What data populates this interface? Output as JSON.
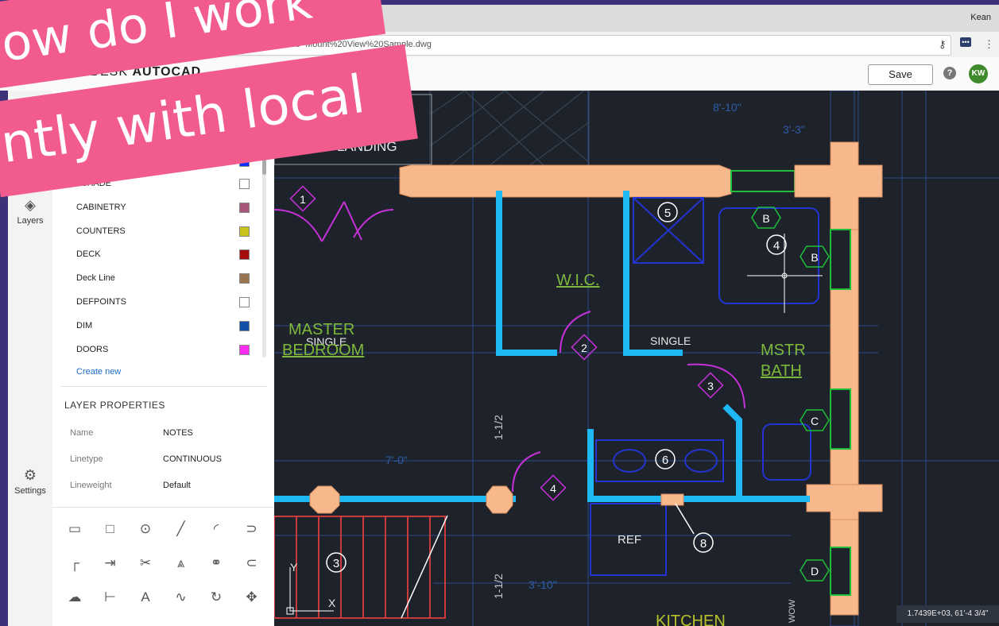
{
  "browser": {
    "user": "Kean",
    "url": "...name=Mount%20View%20Sample.dwg"
  },
  "app": {
    "logo_prefix": "ODESK",
    "logo_name": "AUTOCAD",
    "save_label": "Save",
    "help_glyph": "?",
    "avatar_initials": "KW"
  },
  "rail": {
    "layers_label": "Layers",
    "settings_label": "Settings"
  },
  "layers": [
    {
      "name": "3SHADE",
      "color": "#ffffff"
    },
    {
      "name": "CABINETRY",
      "color": "#a8557a"
    },
    {
      "name": "COUNTERS",
      "color": "#c9c21c"
    },
    {
      "name": "DECK",
      "color": "#a50d0d"
    },
    {
      "name": "Deck Line",
      "color": "#9a7350"
    },
    {
      "name": "DEFPOINTS",
      "color": "#ffffff"
    },
    {
      "name": "DIM",
      "color": "#1150a8"
    },
    {
      "name": "DOORS",
      "color": "#ff2df0"
    }
  ],
  "first_layer_color": "#0a2ef5",
  "create_new_label": "Create new",
  "layer_properties": {
    "title": "LAYER PROPERTIES",
    "name_label": "Name",
    "name_value": "NOTES",
    "linetype_label": "Linetype",
    "linetype_value": "CONTINUOUS",
    "lineweight_label": "Lineweight",
    "lineweight_value": "Default"
  },
  "tools": [
    {
      "name": "measure-icon",
      "glyph": "▭"
    },
    {
      "name": "rectangle-icon",
      "glyph": "□"
    },
    {
      "name": "circle-icon",
      "glyph": "⊙"
    },
    {
      "name": "line-icon",
      "glyph": "╱"
    },
    {
      "name": "arc-icon",
      "glyph": "◜"
    },
    {
      "name": "polyline-icon",
      "glyph": "⊃"
    },
    {
      "name": "fillet-icon",
      "glyph": "┌"
    },
    {
      "name": "extend-icon",
      "glyph": "⇥"
    },
    {
      "name": "trim-icon",
      "glyph": "✂"
    },
    {
      "name": "mirror-icon",
      "glyph": "⩓"
    },
    {
      "name": "copy-icon",
      "glyph": "⚭"
    },
    {
      "name": "offset-icon",
      "glyph": "⊂"
    },
    {
      "name": "cloud-icon",
      "glyph": "☁"
    },
    {
      "name": "dimension-icon",
      "glyph": "⊢"
    },
    {
      "name": "text-icon",
      "glyph": "A"
    },
    {
      "name": "spline-icon",
      "glyph": "∿"
    },
    {
      "name": "rotate-icon",
      "glyph": "↻"
    },
    {
      "name": "move-icon",
      "glyph": "✥"
    }
  ],
  "drawing": {
    "labels": {
      "landing": "LANDING",
      "wic": "W.I.C.",
      "master": "MASTER",
      "bedroom": "BEDROOM",
      "single_overlay": "SINGLE",
      "single": "SINGLE",
      "mstr": "MSTR",
      "bath": "BATH",
      "ref": "REF",
      "kitchen": "KITCHEN",
      "dim_1_1_2_a": "1-1/2",
      "dim_1_1_2_b": "1-1/2",
      "dim_8_10": "8'-10\"",
      "dim_3_3": "3'-3\"",
      "dim_7_0": "7'-0\"",
      "dim_3_10": "3'-10\"",
      "axis_y": "Y",
      "axis_x": "X",
      "wow": "WOW"
    },
    "circle_markers": [
      "5",
      "4",
      "6",
      "3",
      "8"
    ],
    "diamond_markers": [
      "1",
      "2",
      "3",
      "4"
    ],
    "hex_markers": [
      "B",
      "B",
      "C",
      "D"
    ],
    "coords": "1.7439E+03, 61'-4 3/4\""
  },
  "banner": {
    "line1": "ow do I work",
    "line2": "ntly with local"
  }
}
